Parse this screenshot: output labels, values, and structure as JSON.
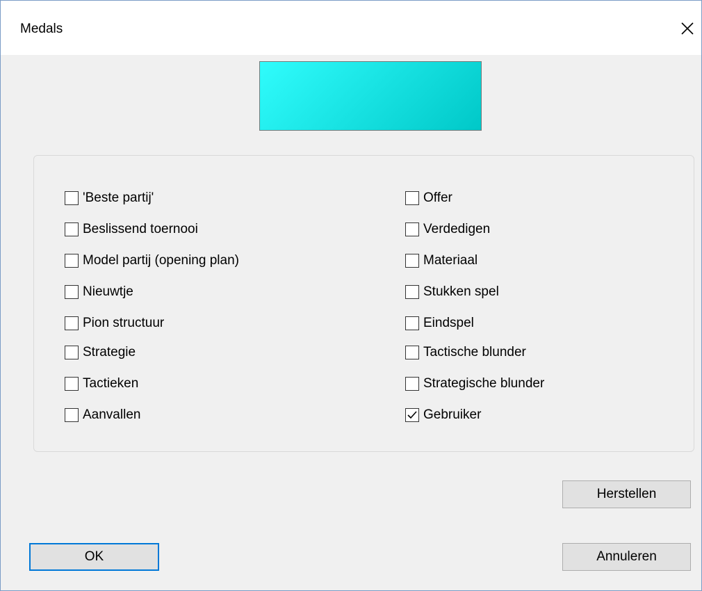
{
  "window": {
    "title": "Medals"
  },
  "colors": {
    "swatch_start": "#30fcfc",
    "swatch_end": "#00c8c8",
    "focus_border": "#0078d7"
  },
  "icons": {
    "close": "close-icon",
    "check": "checkmark-icon"
  },
  "medals": {
    "left": [
      {
        "label": "'Beste partij'",
        "checked": false
      },
      {
        "label": "Beslissend toernooi",
        "checked": false
      },
      {
        "label": "Model partij (opening plan)",
        "checked": false
      },
      {
        "label": "Nieuwtje",
        "checked": false
      },
      {
        "label": "Pion structuur",
        "checked": false
      },
      {
        "label": "Strategie",
        "checked": false
      },
      {
        "label": "Tactieken",
        "checked": false
      },
      {
        "label": "Aanvallen",
        "checked": false
      }
    ],
    "right": [
      {
        "label": "Offer",
        "checked": false
      },
      {
        "label": "Verdedigen",
        "checked": false
      },
      {
        "label": "Materiaal",
        "checked": false
      },
      {
        "label": "Stukken spel",
        "checked": false
      },
      {
        "label": "Eindspel",
        "checked": false
      },
      {
        "label": "Tactische blunder",
        "checked": false
      },
      {
        "label": "Strategische blunder",
        "checked": false
      },
      {
        "label": "Gebruiker",
        "checked": true
      }
    ]
  },
  "buttons": {
    "reset": "Herstellen",
    "ok": "OK",
    "cancel": "Annuleren"
  }
}
